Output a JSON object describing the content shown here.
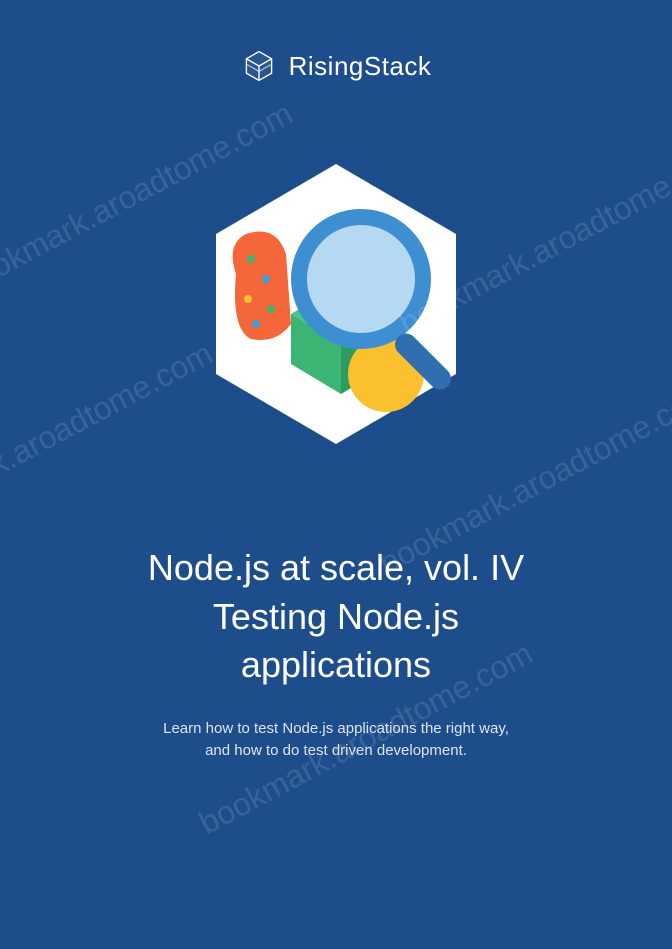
{
  "brand": "RisingStack",
  "title_line1": "Node.js at scale, vol. IV",
  "title_line2": "Testing Node.js",
  "title_line3": "applications",
  "subtitle_line1": "Learn how to test Node.js applications the right way,",
  "subtitle_line2": "and how to do test driven development.",
  "watermark": "bookmark.aroadtome.com"
}
